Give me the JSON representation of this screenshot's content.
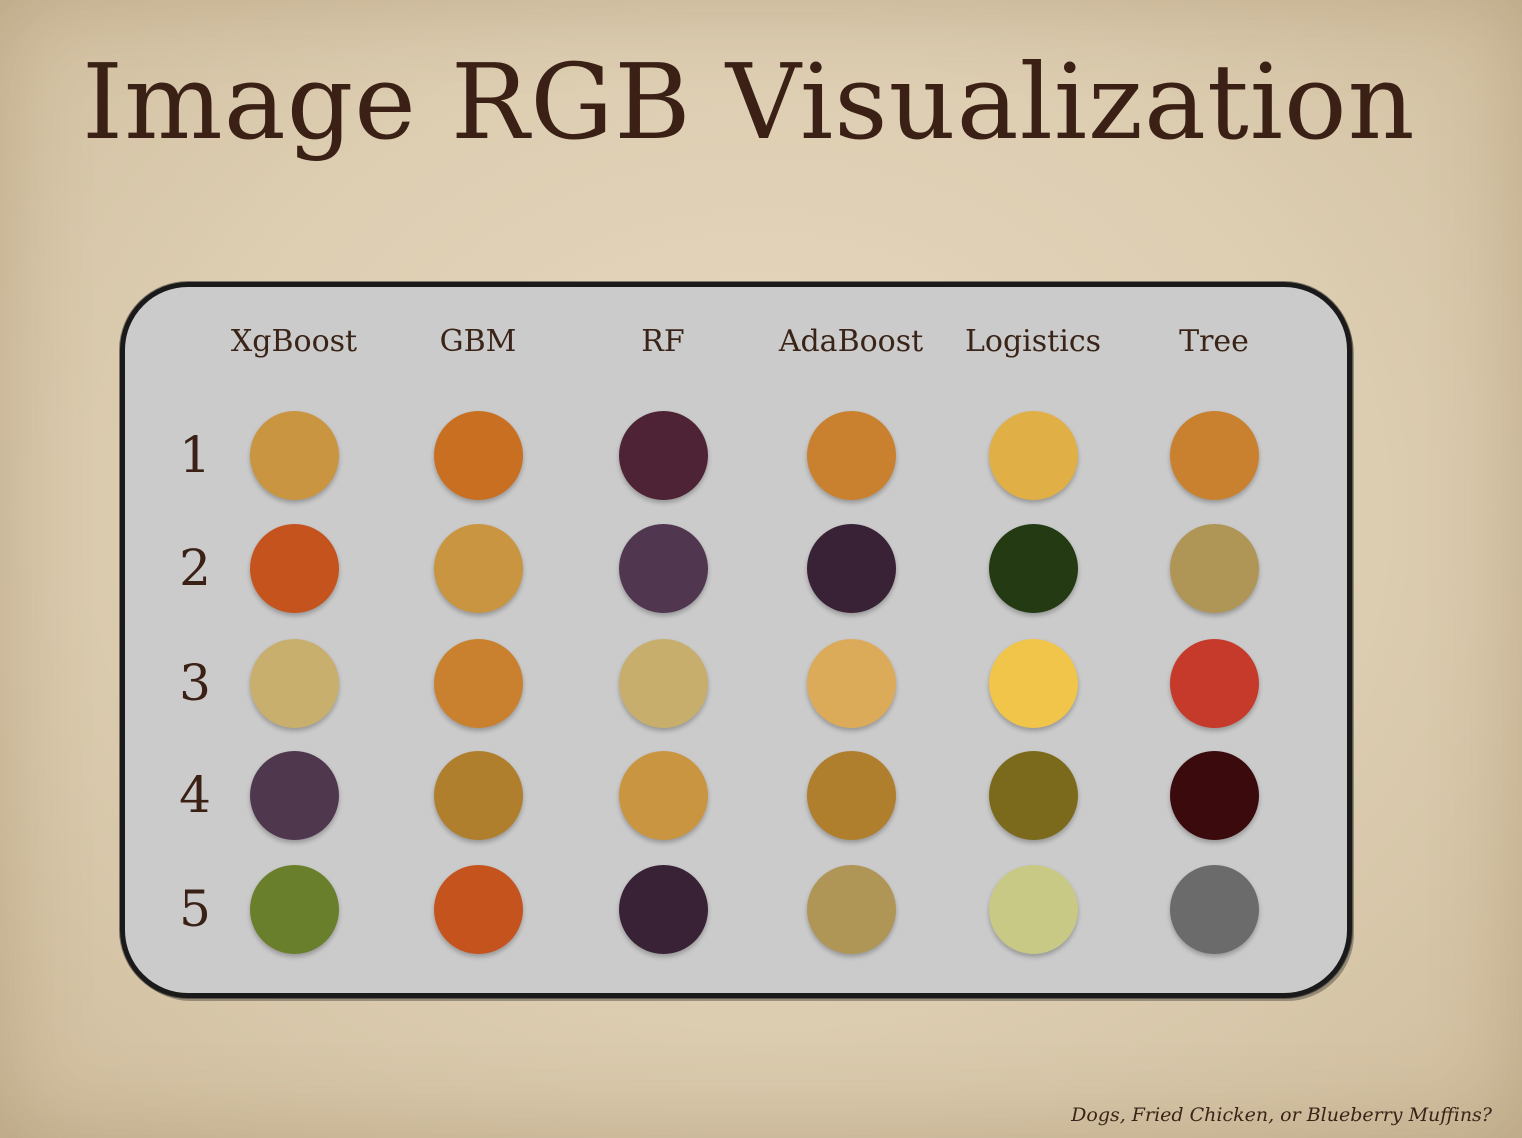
{
  "title": "Image RGB Visualization",
  "footer": "Dogs, Fried Chicken, or Blueberry Muffins?",
  "columns": [
    "XgBoost",
    "GBM",
    "RF",
    "AdaBoost",
    "Logistics",
    "Tree"
  ],
  "rows": [
    {
      "label": "1",
      "colors": [
        "#c99540",
        "#c96f22",
        "#4e2336",
        "#c98130",
        "#e0af45",
        "#c98130"
      ]
    },
    {
      "label": "2",
      "colors": [
        "#c5531e",
        "#c99540",
        "#50374f",
        "#3a2236",
        "#233a12",
        "#b09656"
      ]
    },
    {
      "label": "3",
      "colors": [
        "#c9af6d",
        "#c98130",
        "#c7ae6c",
        "#dcab5a",
        "#f1c44a",
        "#c53a2a"
      ]
    },
    {
      "label": "4",
      "colors": [
        "#4f374d",
        "#af7f2e",
        "#c99540",
        "#af7f2e",
        "#7c6a1c",
        "#3a0a0c"
      ]
    },
    {
      "label": "5",
      "colors": [
        "#6a7f2b",
        "#c5531e",
        "#3a2236",
        "#b09656",
        "#c8c985",
        "#6b6b6b"
      ]
    }
  ]
}
